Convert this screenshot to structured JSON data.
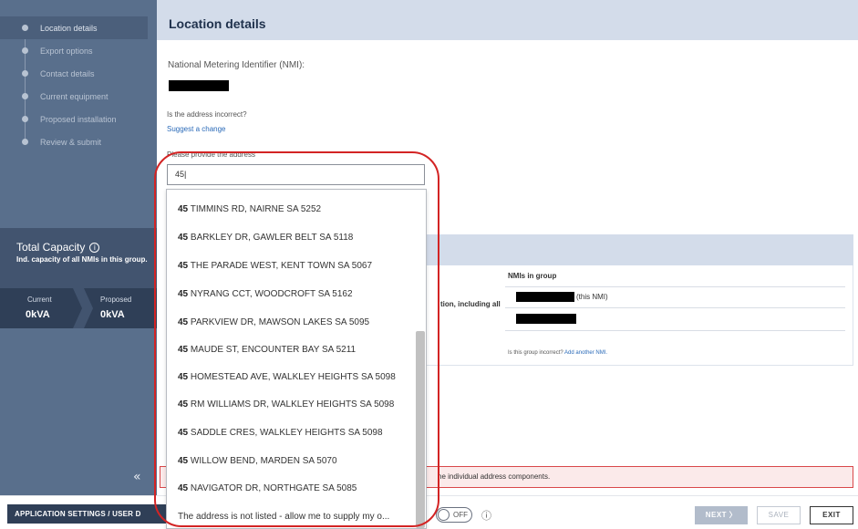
{
  "sidebar": {
    "steps": [
      {
        "label": "Location details",
        "active": true
      },
      {
        "label": "Export options",
        "active": false
      },
      {
        "label": "Contact details",
        "active": false
      },
      {
        "label": "Current equipment",
        "active": false
      },
      {
        "label": "Proposed installation",
        "active": false
      },
      {
        "label": "Review & submit",
        "active": false
      }
    ],
    "capacity": {
      "title": "Total Capacity",
      "info_icon": "ⓘ",
      "subtitle": "Ind. capacity of all NMIs in this group.",
      "current_label": "Current",
      "current_value": "0kVA",
      "proposed_label": "Proposed",
      "proposed_value": "0kVA"
    },
    "collapse_glyph": "«"
  },
  "main": {
    "title": "Location details",
    "nmi_label": "National Metering Identifier (NMI):",
    "address_question": "Is the address incorrect?",
    "suggest_link": "Suggest a change",
    "provide_label": "Please provide the address",
    "address_value": "45",
    "group": {
      "nmis_header": "NMIs in group",
      "partial_text": "tion, including all",
      "this_nmi": "(this NMI)",
      "incorrect_text": "Is this group incorrect?",
      "add_link": "Add another NMI."
    },
    "error_text": "he individual address components."
  },
  "dropdown": {
    "options": [
      {
        "num": "45",
        "rest": "TIMMINS RD, NAIRNE SA 5252"
      },
      {
        "num": "45",
        "rest": "BARKLEY DR, GAWLER BELT SA 5118"
      },
      {
        "num": "45",
        "rest": "THE PARADE WEST, KENT TOWN SA 5067"
      },
      {
        "num": "45",
        "rest": "NYRANG CCT, WOODCROFT SA 5162"
      },
      {
        "num": "45",
        "rest": "PARKVIEW DR, MAWSON LAKES SA 5095"
      },
      {
        "num": "45",
        "rest": "MAUDE ST, ENCOUNTER BAY SA 5211"
      },
      {
        "num": "45",
        "rest": "HOMESTEAD AVE, WALKLEY HEIGHTS SA 5098"
      },
      {
        "num": "45",
        "rest": "RM WILLIAMS DR, WALKLEY HEIGHTS SA 5098"
      },
      {
        "num": "45",
        "rest": "SADDLE CRES, WALKLEY HEIGHTS SA 5098"
      },
      {
        "num": "45",
        "rest": "WILLOW BEND, MARDEN SA 5070"
      },
      {
        "num": "45",
        "rest": "NAVIGATOR DR, NORTHGATE SA 5085"
      }
    ],
    "not_listed": "The address is not listed - allow me to supply my o..."
  },
  "footer": {
    "app_settings": "APPLICATION SETTINGS / USER D",
    "toggle_label": "OFF",
    "info_icon": "ⓘ",
    "next": "NEXT",
    "next_chevron": "〉",
    "save": "SAVE",
    "exit": "EXIT"
  },
  "colors": {
    "sidebar": "#596f8c",
    "sidebar_dark": "#2f3f57",
    "header": "#d3dcea",
    "link": "#2a6ab8",
    "highlight": "#d32424",
    "error_border": "#d9484a"
  }
}
